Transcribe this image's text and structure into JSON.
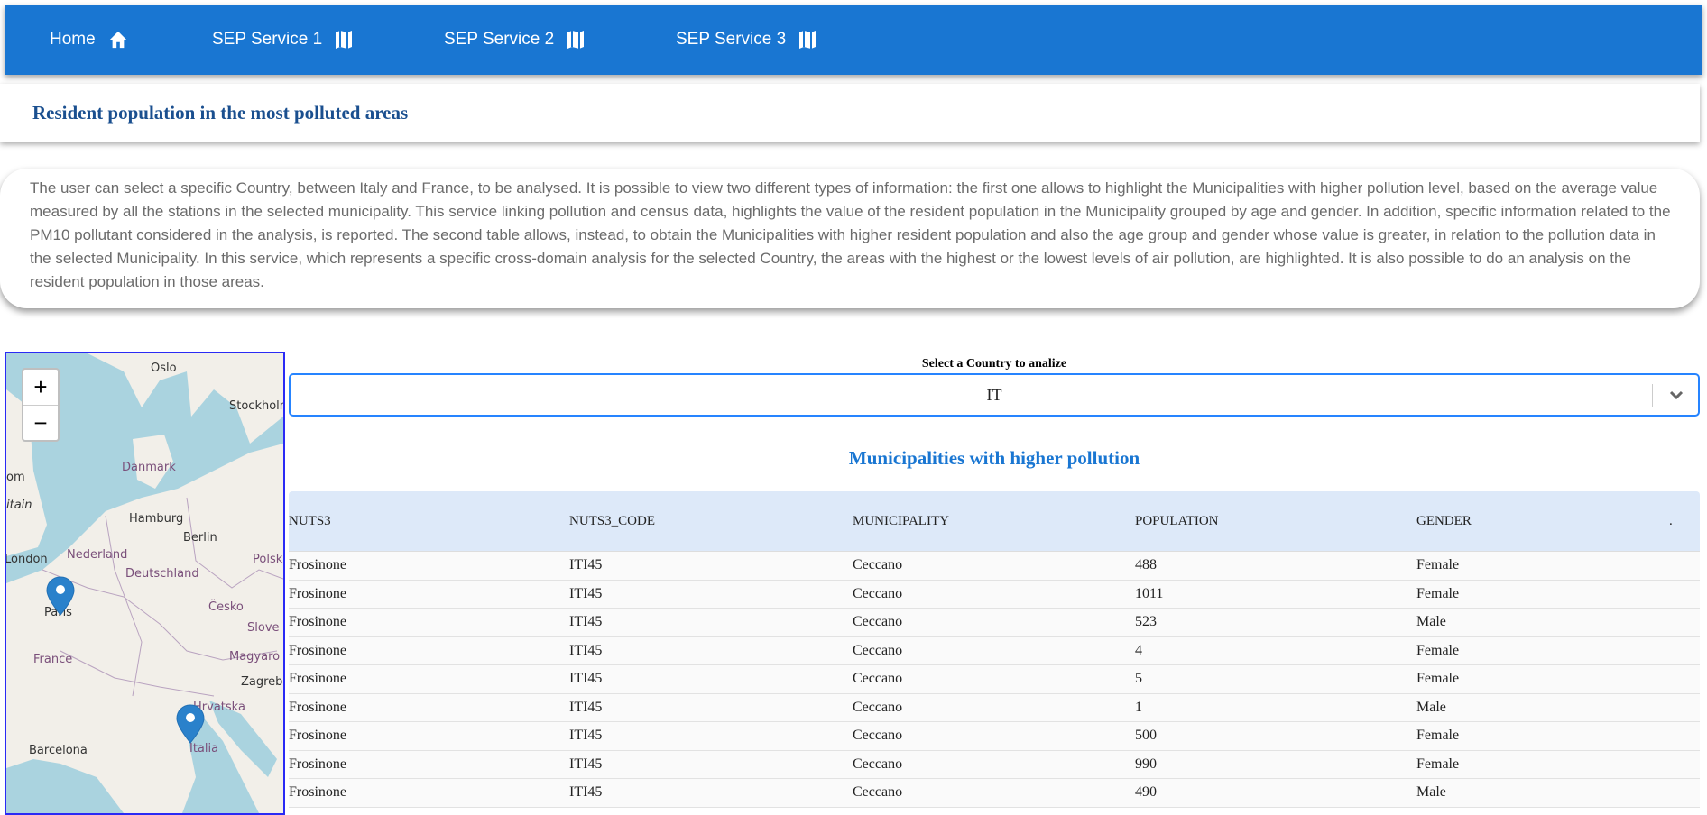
{
  "nav": {
    "items": [
      {
        "label": "Home",
        "icon": "home-icon"
      },
      {
        "label": "SEP Service 1",
        "icon": "map-icon"
      },
      {
        "label": "SEP Service 2",
        "icon": "map-icon"
      },
      {
        "label": "SEP Service 3",
        "icon": "map-icon"
      }
    ],
    "color": "#1976d2"
  },
  "page_title": "Resident population in the most polluted areas",
  "description": "The user can select a specific Country, between Italy and France, to be analysed. It is possible to view two different types of information: the first one allows to highlight the Municipalities with higher pollution level, based on the average value measured by all the stations in the selected municipality. This service linking pollution and census data, highlights the value of the resident population in the Municipality grouped by age and gender. In addition, specific information related to the PM10 pollutant considered in the analysis, is reported. The second table allows, instead, to obtain the Municipalities with higher resident population and also the age group and gender whose value is greater, in relation to the pollution data in the selected Municipality. In this service, which represents a specific cross-domain analysis for the selected Country, the areas with the highest or the lowest levels of air pollution, are highlighted. It is also possible to do an analysis on the resident population in those areas.",
  "map": {
    "zoom_in": "+",
    "zoom_out": "−",
    "labels": {
      "oslo": "Oslo",
      "stockholm": "Stockholm",
      "danmark": "Danmark",
      "kingdom": "om",
      "britain": "itain",
      "hamburg": "Hamburg",
      "berlin": "Berlin",
      "nederland": "Nederland",
      "london": "London",
      "polska": "Polsk",
      "deutschland": "Deutschland",
      "paris": "Paris",
      "cesko": "Česko",
      "slovenija": "Slove",
      "france": "France",
      "magyar": "Magyaro",
      "zagreb": "Zagreb",
      "hrvatska": "Hrvatska",
      "italia": "Italia",
      "barcelona": "Barcelona"
    },
    "markers": [
      "Paris",
      "Italia"
    ]
  },
  "select": {
    "label": "Select a Country to analize",
    "value": "IT"
  },
  "table": {
    "title": "Municipalities with higher pollution",
    "columns": [
      "NUTS3",
      "NUTS3_CODE",
      "MUNICIPALITY",
      "POPULATION",
      "GENDER",
      "."
    ],
    "rows": [
      [
        "Frosinone",
        "ITI45",
        "Ceccano",
        "488",
        "Female"
      ],
      [
        "Frosinone",
        "ITI45",
        "Ceccano",
        "1011",
        "Female"
      ],
      [
        "Frosinone",
        "ITI45",
        "Ceccano",
        "523",
        "Male"
      ],
      [
        "Frosinone",
        "ITI45",
        "Ceccano",
        "4",
        "Female"
      ],
      [
        "Frosinone",
        "ITI45",
        "Ceccano",
        "5",
        "Female"
      ],
      [
        "Frosinone",
        "ITI45",
        "Ceccano",
        "1",
        "Male"
      ],
      [
        "Frosinone",
        "ITI45",
        "Ceccano",
        "500",
        "Female"
      ],
      [
        "Frosinone",
        "ITI45",
        "Ceccano",
        "990",
        "Female"
      ],
      [
        "Frosinone",
        "ITI45",
        "Ceccano",
        "490",
        "Male"
      ]
    ]
  }
}
